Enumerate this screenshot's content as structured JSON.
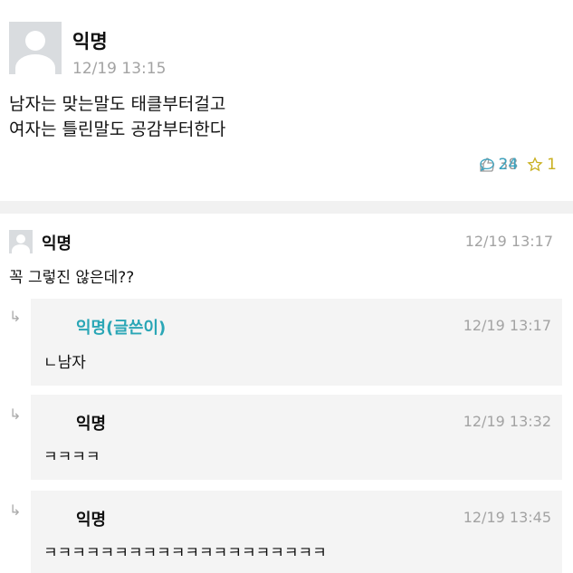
{
  "post": {
    "author": "익명",
    "time": "12/19 13:15",
    "lines": [
      "남자는 맞는말도 태클부터걸고",
      "여자는 틀린말도 공감부터한다"
    ],
    "likes": "38",
    "comments": "24",
    "scraps": "1",
    "icons": [
      "thumbs-up-icon",
      "speech-bubble-icon",
      "star-icon"
    ]
  },
  "comments": [
    {
      "author": "익명",
      "time": "12/19 13:17",
      "text": "꼭 그렇진 않은데??"
    }
  ],
  "replies": [
    {
      "author": "익명(글쓴이)",
      "time": "12/19 13:17",
      "text": "ㄴ남자"
    },
    {
      "author": "익명",
      "time": "12/19 13:32",
      "text": "ㅋㅋㅋㅋ"
    },
    {
      "author": "익명",
      "time": "12/19 13:45",
      "text": "ㅋㅋㅋㅋㅋㅋㅋㅋㅋㅋㅋㅋㅋㅋㅋㅋㅋㅋㅋㅋ"
    }
  ],
  "colors": {
    "op_author": "#2aa6b6",
    "comment_count": "#3aa3c0",
    "scrap_count": "#c9b020",
    "meta": "#a3a3a3"
  }
}
